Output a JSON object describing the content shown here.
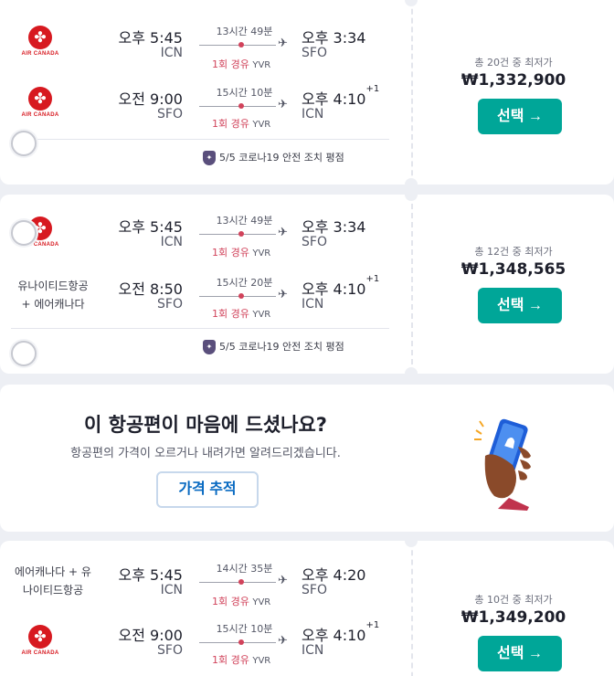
{
  "cards": [
    {
      "legs": [
        {
          "airline_wordmark": "AIR CANADA",
          "dep_time": "오후 5:45",
          "dep_code": "ICN",
          "duration": "13시간 49분",
          "stops": "1회 경유",
          "via": "YVR",
          "arr_time": "오후 3:34",
          "arr_sup": "",
          "arr_code": "SFO"
        },
        {
          "airline_wordmark": "AIR CANADA",
          "dep_time": "오전 9:00",
          "dep_code": "SFO",
          "duration": "15시간 10분",
          "stops": "1회 경유",
          "via": "YVR",
          "arr_time": "오후 4:10",
          "arr_sup": "+1",
          "arr_code": "ICN"
        }
      ],
      "safety": "5/5 코로나19 안전 조치 평점",
      "price_note": "총 20건 중 최저가",
      "price": "₩1,332,900",
      "select_label": "선택 →"
    },
    {
      "legs": [
        {
          "airline_wordmark": "AIR CANADA",
          "dep_time": "오후 5:45",
          "dep_code": "ICN",
          "duration": "13시간 49분",
          "stops": "1회 경유",
          "via": "YVR",
          "arr_time": "오후 3:34",
          "arr_sup": "",
          "arr_code": "SFO"
        },
        {
          "airline_text_1": "유나이티드항공",
          "airline_text_2": "+ 에어캐나다",
          "dep_time": "오전 8:50",
          "dep_code": "SFO",
          "duration": "15시간 20분",
          "stops": "1회 경유",
          "via": "YVR",
          "arr_time": "오후 4:10",
          "arr_sup": "+1",
          "arr_code": "ICN"
        }
      ],
      "safety": "5/5 코로나19 안전 조치 평점",
      "price_note": "총 12건 중 최저가",
      "price": "₩1,348,565",
      "select_label": "선택 →"
    },
    {
      "legs": [
        {
          "airline_text_1": "에어캐나다 + 유",
          "airline_text_2": "나이티드항공",
          "dep_time": "오후 5:45",
          "dep_code": "ICN",
          "duration": "14시간 35분",
          "stops": "1회 경유",
          "via": "YVR",
          "arr_time": "오후 4:20",
          "arr_sup": "",
          "arr_code": "SFO"
        },
        {
          "airline_wordmark": "AIR CANADA",
          "dep_time": "오전 9:00",
          "dep_code": "SFO",
          "duration": "15시간 10분",
          "stops": "1회 경유",
          "via": "YVR",
          "arr_time": "오후 4:10",
          "arr_sup": "+1",
          "arr_code": "ICN"
        }
      ],
      "price_note": "총 10건 중 최저가",
      "price": "₩1,349,200",
      "select_label": "선택 →"
    }
  ],
  "promo": {
    "title": "이 항공편이 마음에 드셨나요?",
    "subtitle": "항공편의 가격이 오르거나 내려가면 알려드리겠습니다.",
    "button": "가격 추적"
  },
  "icons": {
    "airline_logo": "maple-leaf-icon",
    "plane": "plane-icon",
    "shield": "shield-icon",
    "phone": "phone-hand-illustration"
  },
  "colors": {
    "accent": "#00a698",
    "stop_red": "#d1435b",
    "air_canada_red": "#d71920",
    "link_blue": "#0769c1"
  }
}
